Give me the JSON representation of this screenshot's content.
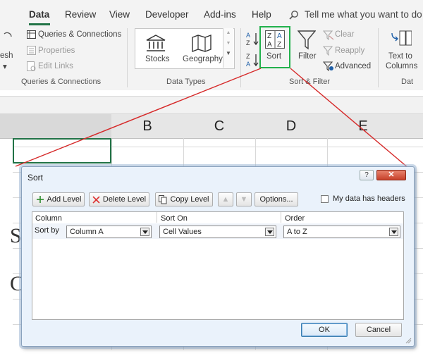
{
  "ribbon": {
    "tabs": [
      "Data",
      "Review",
      "View",
      "Developer",
      "Add-ins",
      "Help"
    ],
    "tell_me": "Tell me what you want to do",
    "queries": {
      "refresh_partial": "esh",
      "items": [
        "Queries & Connections",
        "Properties",
        "Edit Links"
      ],
      "group_label": "Queries & Connections"
    },
    "data_types": {
      "items": [
        "Stocks",
        "Geography"
      ],
      "group_label": "Data Types"
    },
    "sort_filter": {
      "sort": "Sort",
      "filter": "Filter",
      "clear": "Clear",
      "reapply": "Reapply",
      "advanced": "Advanced",
      "group_label": "Sort & Filter"
    },
    "data_tools": {
      "text_to_line1": "Text to",
      "text_to_line2": "Columns",
      "group_label_partial": "Dat"
    }
  },
  "sheet": {
    "columns": [
      "B",
      "C",
      "D",
      "E"
    ],
    "row_fragments": [
      "S",
      "C"
    ]
  },
  "dialog": {
    "title": "Sort",
    "help": "?",
    "buttons": {
      "add_level": "Add Level",
      "delete_level": "Delete Level",
      "copy_level": "Copy Level",
      "options": "Options...",
      "ok": "OK",
      "cancel": "Cancel"
    },
    "headers_checkbox": {
      "label": "My data has headers",
      "checked": false
    },
    "columns": {
      "column": "Column",
      "sort_on": "Sort On",
      "order": "Order"
    },
    "row": {
      "label": "Sort by",
      "column": "Column A",
      "sort_on": "Cell Values",
      "order": "A to Z"
    }
  },
  "colors": {
    "excel_green": "#217346",
    "highlight_green": "#22b14c",
    "callout_red": "#d62a2a"
  }
}
